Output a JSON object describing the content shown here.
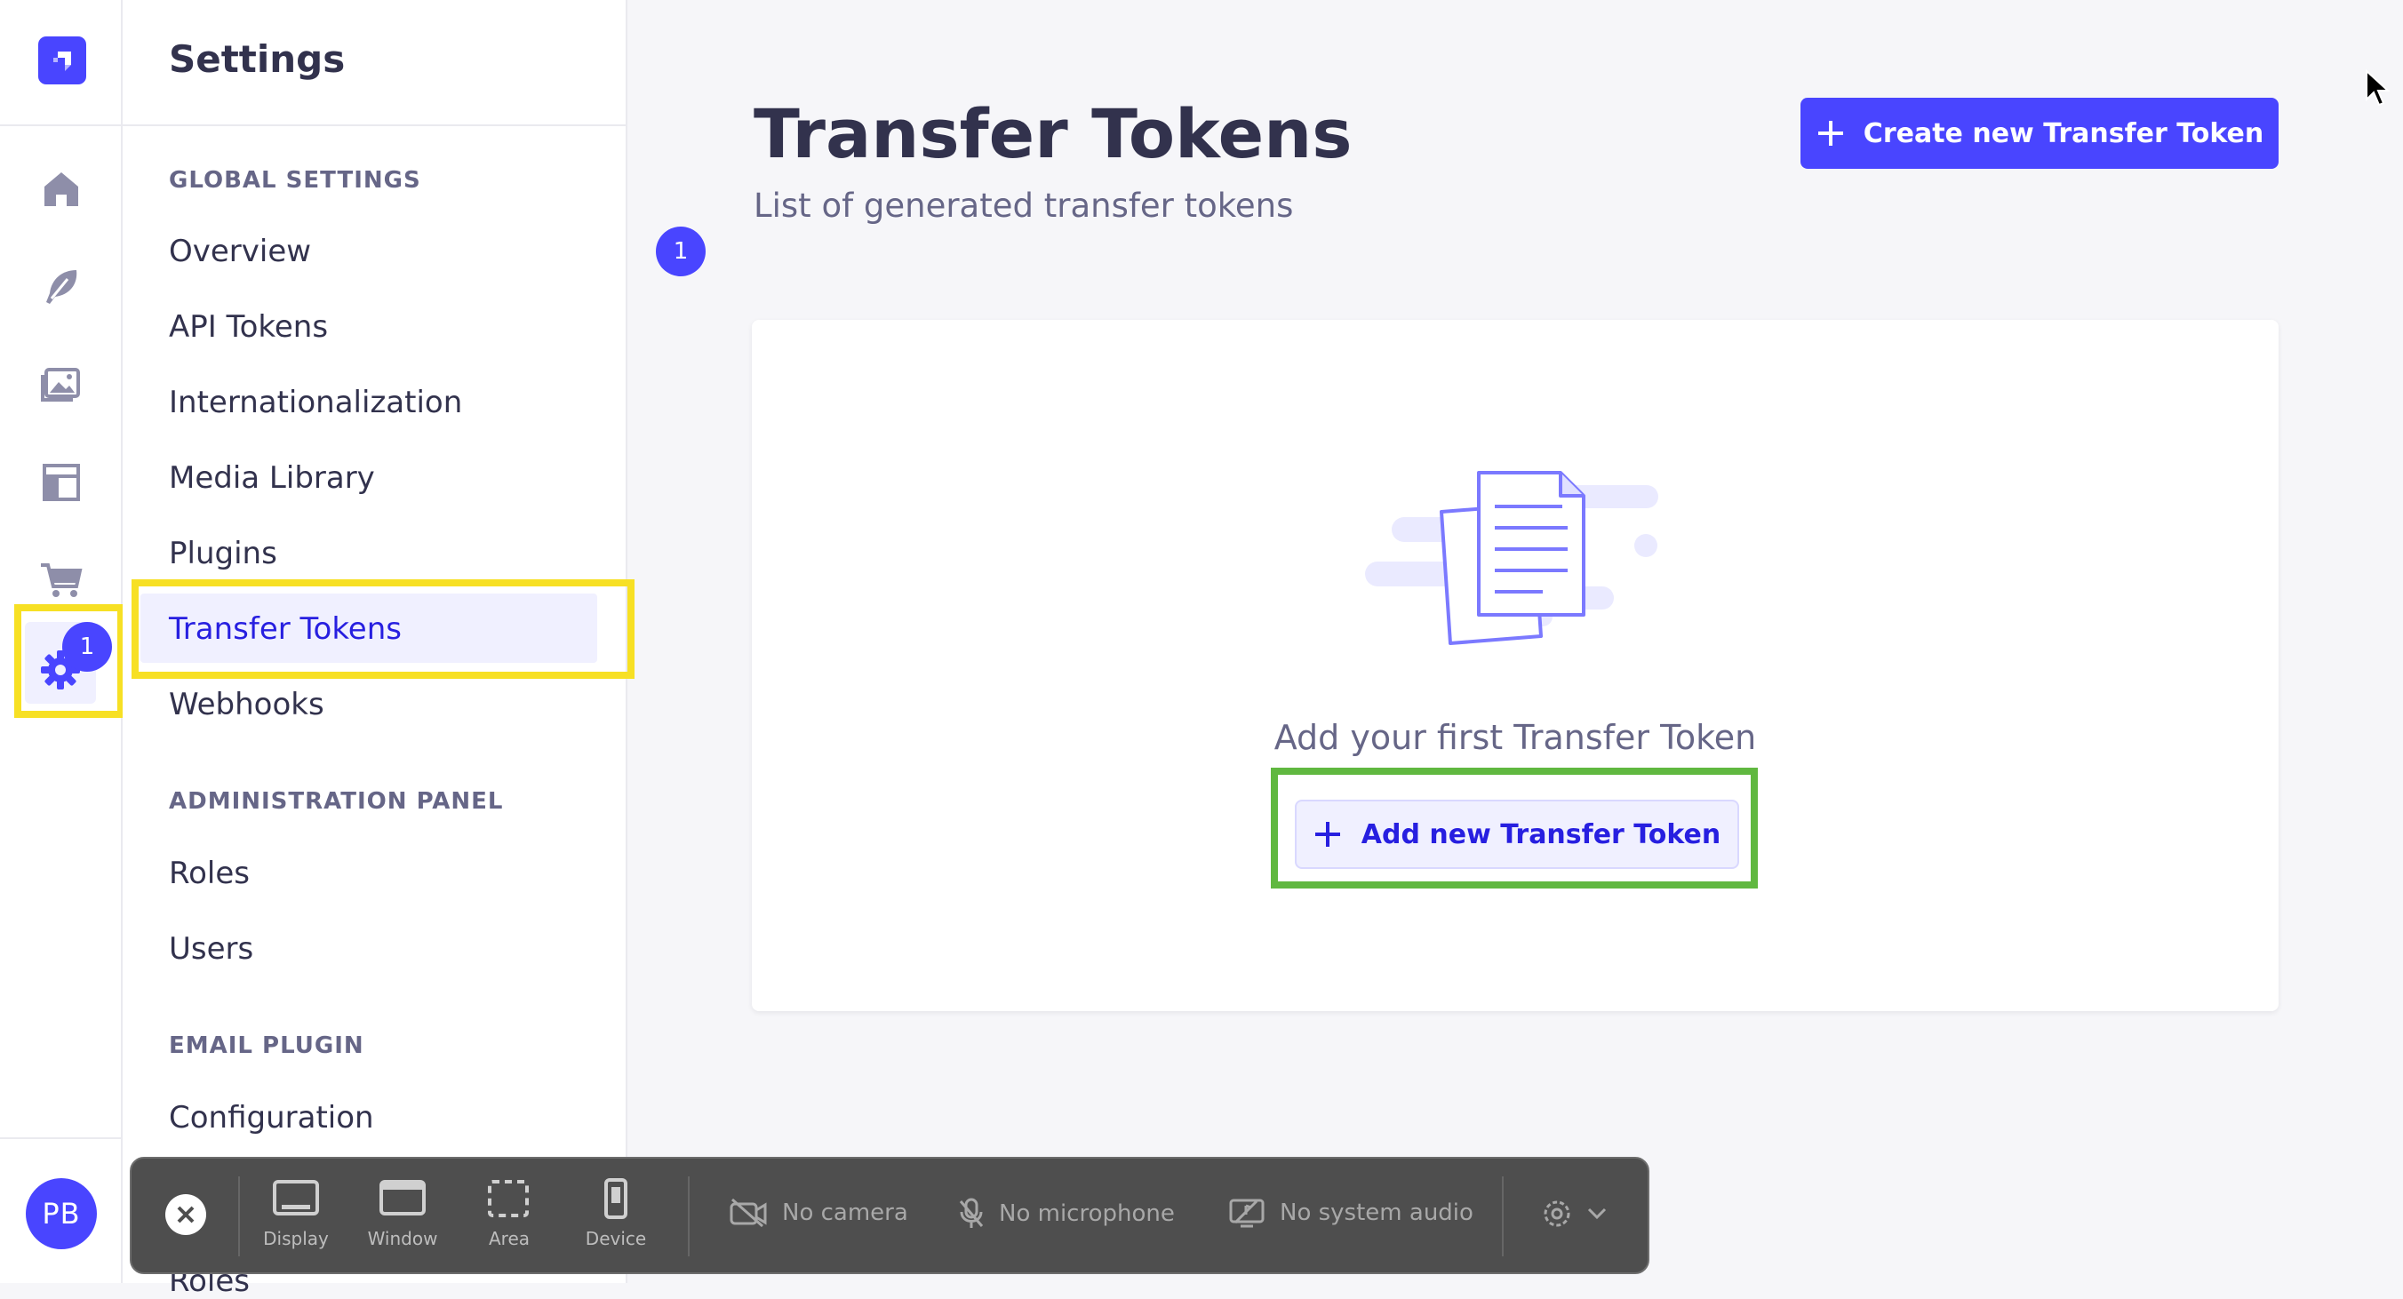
{
  "rail": {
    "settings_badge": "1",
    "avatar_initials": "PB",
    "icons": [
      "home-icon",
      "feather-icon",
      "media-icon",
      "layout-icon",
      "cart-icon",
      "gear-icon"
    ]
  },
  "subnav": {
    "title": "Settings",
    "sections": [
      {
        "label": "GLOBAL SETTINGS",
        "items": [
          "Overview",
          "API Tokens",
          "Internationalization",
          "Media Library",
          "Plugins",
          "Transfer Tokens",
          "Webhooks"
        ]
      },
      {
        "label": "ADMINISTRATION PANEL",
        "items": [
          "Roles",
          "Users"
        ]
      },
      {
        "label": "EMAIL PLUGIN",
        "items": [
          "Configuration"
        ]
      }
    ],
    "overview_badge": "1",
    "partial_item": "Roles"
  },
  "main": {
    "title": "Transfer Tokens",
    "subtitle": "List of generated transfer tokens",
    "create_button": "Create new Transfer Token",
    "empty_state_text": "Add your first Transfer Token",
    "add_button": "Add new Transfer Token"
  },
  "recorder": {
    "tools": [
      "Display",
      "Window",
      "Area",
      "Device"
    ],
    "camera": "No camera",
    "microphone": "No microphone",
    "system_audio": "No system audio"
  },
  "colors": {
    "primary": "#4945ff",
    "highlight_yellow": "#f7e024",
    "highlight_green": "#60b840"
  }
}
